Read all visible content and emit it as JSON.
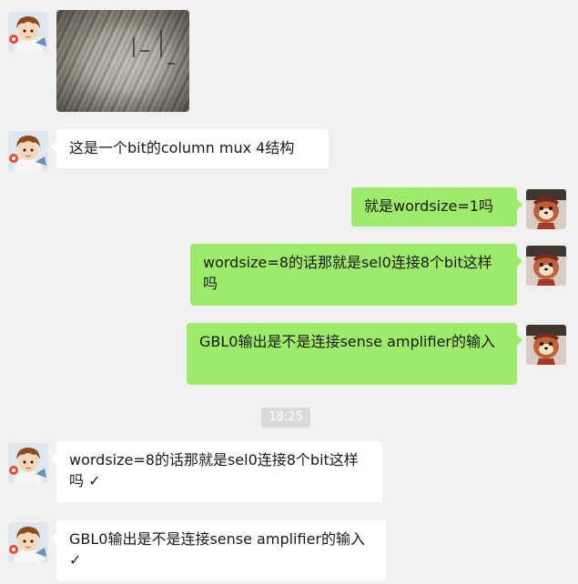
{
  "messages": [
    {
      "kind": "image",
      "side": "left"
    },
    {
      "kind": "text",
      "side": "left",
      "text": "这是一个bit的column mux 4结构"
    },
    {
      "kind": "text",
      "side": "right",
      "text": "就是wordsize=1吗"
    },
    {
      "kind": "text",
      "side": "right",
      "text": "wordsize=8的话那就是sel0连接8个bit这样吗"
    },
    {
      "kind": "text",
      "side": "right",
      "text": "GBL0输出是不是连接sense amplifier的输入"
    },
    {
      "kind": "text",
      "side": "left",
      "text": "wordsize=8的话那就是sel0连接8个bit这样吗 ✓"
    },
    {
      "kind": "text",
      "side": "left",
      "text": "GBL0输出是不是连接sense amplifier的输入 ✓"
    }
  ],
  "timestamp": "18:25",
  "colors": {
    "background": "#f1f1f1",
    "incoming_bubble": "#ffffff",
    "outgoing_bubble": "#9eea6a",
    "timestamp_pill": "#dadada"
  },
  "icons": {
    "contact_avatar": "anime-avatar-icon",
    "self_avatar": "plush-toy-avatar-icon"
  }
}
